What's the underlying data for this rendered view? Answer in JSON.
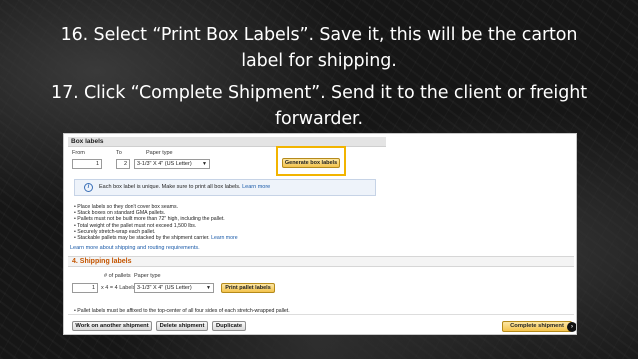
{
  "captions": {
    "line1": "16. Select “Print Box Labels”. Save it, this will be the carton",
    "line2": "label for shipping.",
    "line3": "17. Click “Complete Shipment”. Send it to the client or freight",
    "line4": "forwarder."
  },
  "box_labels": {
    "header": "Box labels",
    "from_label": "From",
    "to_label": "To",
    "paper_label": "Paper type",
    "from_value": "1",
    "to_value": "2",
    "paper_value": "3-1/3\" X 4\" (US Letter)",
    "generate_button": "Generate box labels"
  },
  "info": {
    "text": "Each box label is unique. Make sure to print all box labels.",
    "link": "Learn more"
  },
  "bullets": [
    "Place labels so they don't cover box seams.",
    "Stack boxes on standard GMA pallets.",
    "Pallets must not be built more than 72\" high, including the pallet.",
    "Total weight of the pallet must not exceed 1,500 lbs.",
    "Securely stretch-wrap each pallet.",
    "Stackable pallets may be stacked by the shipment carrier."
  ],
  "bullets_link": "Learn more",
  "more_link": "Learn more about shipping and routing requirements.",
  "shipping_labels": {
    "title": "4. Shipping labels",
    "pallets_label": "# of pallets",
    "paper_label": "Paper type",
    "pallets_value": "1",
    "times_text": "x 4 = 4 Labels",
    "paper_value": "3-1/3\" X 4\" (US Letter)",
    "print_button": "Print pallet labels",
    "note": "Pallet labels must be affixed to the top-center of all four sides of each stretch-wrapped pallet."
  },
  "footer": {
    "work_another": "Work on another shipment",
    "delete": "Delete shipment",
    "duplicate": "Duplicate",
    "complete": "Complete shipment"
  },
  "colors": {
    "highlight": "#f2b400",
    "section_title": "#c45500",
    "link": "#1a5aa8"
  }
}
